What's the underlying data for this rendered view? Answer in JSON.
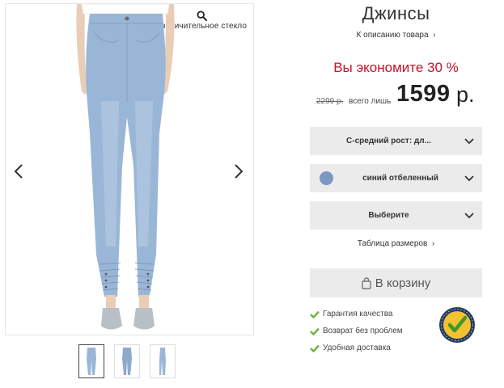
{
  "gallery": {
    "zoom_label": "Увеличительное стекло",
    "thumbnails": [
      {
        "name": "thumb-front",
        "active": true
      },
      {
        "name": "thumb-back",
        "active": false
      },
      {
        "name": "thumb-side",
        "active": false
      }
    ]
  },
  "product": {
    "title": "Джинсы",
    "description_link": "К описанию товара",
    "savings": "Вы экономите 30 %",
    "old_price": "2299 р.",
    "only_label": "всего лишь",
    "price": "1599",
    "currency": "р."
  },
  "options": {
    "size_type": "С-средний рост: дл...",
    "color": "синий отбеленный",
    "color_hex": "#7b98c2",
    "size": "Выберите",
    "size_table_link": "Таблица размеров"
  },
  "cart": {
    "button_label": "В корзину"
  },
  "benefits": [
    "Гарантия качества",
    "Возврат без проблем",
    "Удобная доставка"
  ],
  "colors": {
    "accent_red": "#c8102e",
    "check_green": "#6db33f",
    "select_bg": "#ebebeb",
    "denim": "#9ab6d6"
  }
}
